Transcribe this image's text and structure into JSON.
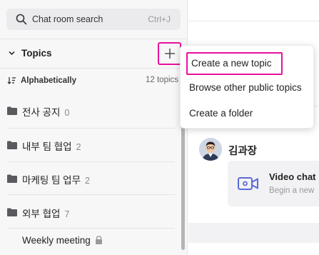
{
  "search": {
    "placeholder": "Chat room search",
    "shortcut": "Ctrl+J"
  },
  "topics": {
    "title": "Topics",
    "sort_label": "Alphabetically",
    "count_label": "12 topics",
    "items": [
      {
        "name": "전사 공지",
        "count": "0"
      },
      {
        "name": "내부 팀 협업",
        "count": "2"
      },
      {
        "name": "마케팅 팀 업무",
        "count": "2"
      },
      {
        "name": "외부 협업",
        "count": "7"
      }
    ],
    "weekly": "Weekly meeting"
  },
  "menu": {
    "items": [
      "Create a new topic",
      "Browse other public topics",
      "Create a folder"
    ]
  },
  "chat": {
    "user": "김과장",
    "video_title": "Video chat",
    "video_sub": "Begin a new"
  },
  "colors": {
    "highlight": "#e8119b",
    "video_icon": "#5b6bd6"
  }
}
